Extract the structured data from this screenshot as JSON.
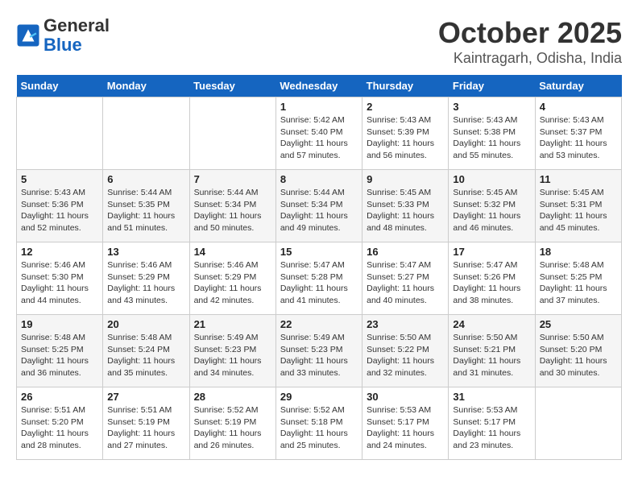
{
  "header": {
    "logo_general": "General",
    "logo_blue": "Blue",
    "month": "October 2025",
    "location": "Kaintragarh, Odisha, India"
  },
  "days_of_week": [
    "Sunday",
    "Monday",
    "Tuesday",
    "Wednesday",
    "Thursday",
    "Friday",
    "Saturday"
  ],
  "weeks": [
    [
      {
        "day": "",
        "info": ""
      },
      {
        "day": "",
        "info": ""
      },
      {
        "day": "",
        "info": ""
      },
      {
        "day": "1",
        "info": "Sunrise: 5:42 AM\nSunset: 5:40 PM\nDaylight: 11 hours\nand 57 minutes."
      },
      {
        "day": "2",
        "info": "Sunrise: 5:43 AM\nSunset: 5:39 PM\nDaylight: 11 hours\nand 56 minutes."
      },
      {
        "day": "3",
        "info": "Sunrise: 5:43 AM\nSunset: 5:38 PM\nDaylight: 11 hours\nand 55 minutes."
      },
      {
        "day": "4",
        "info": "Sunrise: 5:43 AM\nSunset: 5:37 PM\nDaylight: 11 hours\nand 53 minutes."
      }
    ],
    [
      {
        "day": "5",
        "info": "Sunrise: 5:43 AM\nSunset: 5:36 PM\nDaylight: 11 hours\nand 52 minutes."
      },
      {
        "day": "6",
        "info": "Sunrise: 5:44 AM\nSunset: 5:35 PM\nDaylight: 11 hours\nand 51 minutes."
      },
      {
        "day": "7",
        "info": "Sunrise: 5:44 AM\nSunset: 5:34 PM\nDaylight: 11 hours\nand 50 minutes."
      },
      {
        "day": "8",
        "info": "Sunrise: 5:44 AM\nSunset: 5:34 PM\nDaylight: 11 hours\nand 49 minutes."
      },
      {
        "day": "9",
        "info": "Sunrise: 5:45 AM\nSunset: 5:33 PM\nDaylight: 11 hours\nand 48 minutes."
      },
      {
        "day": "10",
        "info": "Sunrise: 5:45 AM\nSunset: 5:32 PM\nDaylight: 11 hours\nand 46 minutes."
      },
      {
        "day": "11",
        "info": "Sunrise: 5:45 AM\nSunset: 5:31 PM\nDaylight: 11 hours\nand 45 minutes."
      }
    ],
    [
      {
        "day": "12",
        "info": "Sunrise: 5:46 AM\nSunset: 5:30 PM\nDaylight: 11 hours\nand 44 minutes."
      },
      {
        "day": "13",
        "info": "Sunrise: 5:46 AM\nSunset: 5:29 PM\nDaylight: 11 hours\nand 43 minutes."
      },
      {
        "day": "14",
        "info": "Sunrise: 5:46 AM\nSunset: 5:29 PM\nDaylight: 11 hours\nand 42 minutes."
      },
      {
        "day": "15",
        "info": "Sunrise: 5:47 AM\nSunset: 5:28 PM\nDaylight: 11 hours\nand 41 minutes."
      },
      {
        "day": "16",
        "info": "Sunrise: 5:47 AM\nSunset: 5:27 PM\nDaylight: 11 hours\nand 40 minutes."
      },
      {
        "day": "17",
        "info": "Sunrise: 5:47 AM\nSunset: 5:26 PM\nDaylight: 11 hours\nand 38 minutes."
      },
      {
        "day": "18",
        "info": "Sunrise: 5:48 AM\nSunset: 5:25 PM\nDaylight: 11 hours\nand 37 minutes."
      }
    ],
    [
      {
        "day": "19",
        "info": "Sunrise: 5:48 AM\nSunset: 5:25 PM\nDaylight: 11 hours\nand 36 minutes."
      },
      {
        "day": "20",
        "info": "Sunrise: 5:48 AM\nSunset: 5:24 PM\nDaylight: 11 hours\nand 35 minutes."
      },
      {
        "day": "21",
        "info": "Sunrise: 5:49 AM\nSunset: 5:23 PM\nDaylight: 11 hours\nand 34 minutes."
      },
      {
        "day": "22",
        "info": "Sunrise: 5:49 AM\nSunset: 5:23 PM\nDaylight: 11 hours\nand 33 minutes."
      },
      {
        "day": "23",
        "info": "Sunrise: 5:50 AM\nSunset: 5:22 PM\nDaylight: 11 hours\nand 32 minutes."
      },
      {
        "day": "24",
        "info": "Sunrise: 5:50 AM\nSunset: 5:21 PM\nDaylight: 11 hours\nand 31 minutes."
      },
      {
        "day": "25",
        "info": "Sunrise: 5:50 AM\nSunset: 5:20 PM\nDaylight: 11 hours\nand 30 minutes."
      }
    ],
    [
      {
        "day": "26",
        "info": "Sunrise: 5:51 AM\nSunset: 5:20 PM\nDaylight: 11 hours\nand 28 minutes."
      },
      {
        "day": "27",
        "info": "Sunrise: 5:51 AM\nSunset: 5:19 PM\nDaylight: 11 hours\nand 27 minutes."
      },
      {
        "day": "28",
        "info": "Sunrise: 5:52 AM\nSunset: 5:19 PM\nDaylight: 11 hours\nand 26 minutes."
      },
      {
        "day": "29",
        "info": "Sunrise: 5:52 AM\nSunset: 5:18 PM\nDaylight: 11 hours\nand 25 minutes."
      },
      {
        "day": "30",
        "info": "Sunrise: 5:53 AM\nSunset: 5:17 PM\nDaylight: 11 hours\nand 24 minutes."
      },
      {
        "day": "31",
        "info": "Sunrise: 5:53 AM\nSunset: 5:17 PM\nDaylight: 11 hours\nand 23 minutes."
      },
      {
        "day": "",
        "info": ""
      }
    ]
  ]
}
